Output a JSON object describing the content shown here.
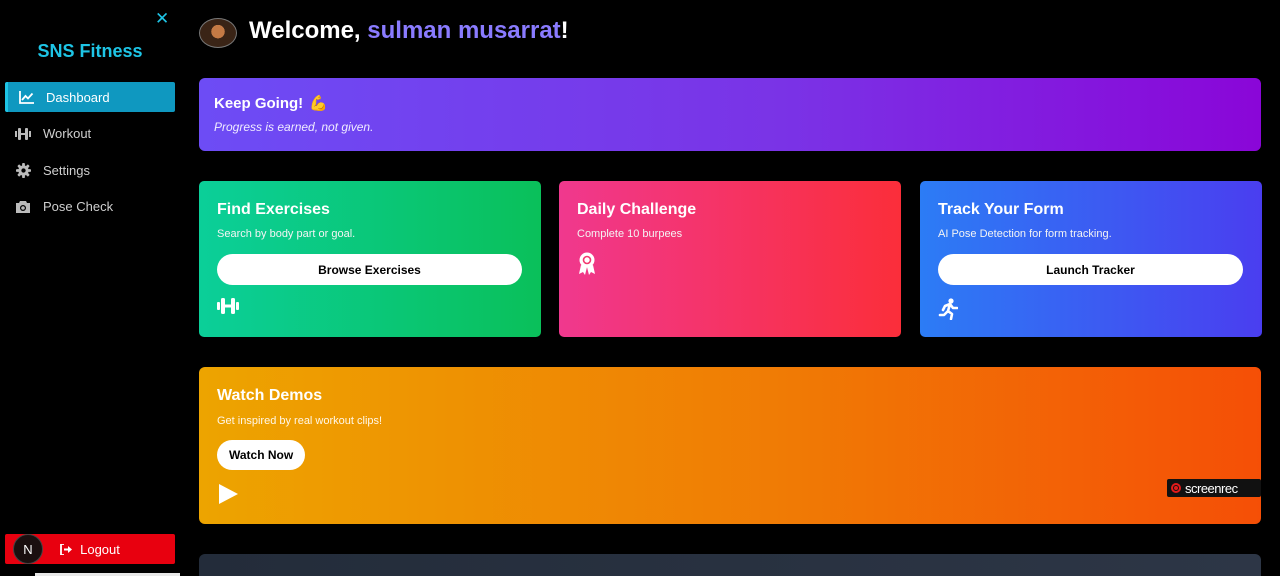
{
  "sidebar": {
    "close_icon": "close-icon",
    "brand": "SNS Fitness",
    "items": [
      {
        "label": "Dashboard",
        "icon": "chart-line-icon",
        "active": true
      },
      {
        "label": "Workout",
        "icon": "dumbbell-icon",
        "active": false
      },
      {
        "label": "Settings",
        "icon": "gear-icon",
        "active": false
      },
      {
        "label": "Pose Check",
        "icon": "camera-icon",
        "active": false
      }
    ],
    "logout_label": "Logout",
    "logout_icon": "sign-out-icon",
    "badge_letter": "N"
  },
  "header": {
    "welcome_prefix": "Welcome, ",
    "username": "sulman musarrat",
    "welcome_suffix": "!"
  },
  "banner": {
    "title": "Keep Going!",
    "emoji": "💪",
    "subtitle": "Progress is earned, not given."
  },
  "cards": [
    {
      "title": "Find Exercises",
      "subtitle": "Search by body part or goal.",
      "button": "Browse Exercises",
      "icon": "dumbbell-icon"
    },
    {
      "title": "Daily Challenge",
      "subtitle": "Complete 10 burpees",
      "icon": "award-ribbon-icon"
    },
    {
      "title": "Track Your Form",
      "subtitle": "AI Pose Detection for form tracking.",
      "button": "Launch Tracker",
      "icon": "running-person-icon"
    }
  ],
  "demos": {
    "title": "Watch Demos",
    "subtitle": "Get inspired by real workout clips!",
    "button": "Watch Now",
    "icon": "play-icon"
  },
  "watermark": {
    "text": "screenrec"
  },
  "colors": {
    "brand": "#1ec5e6",
    "username": "#8a7bff",
    "logout": "#e8000f",
    "active_nav": "#0f98c0"
  }
}
